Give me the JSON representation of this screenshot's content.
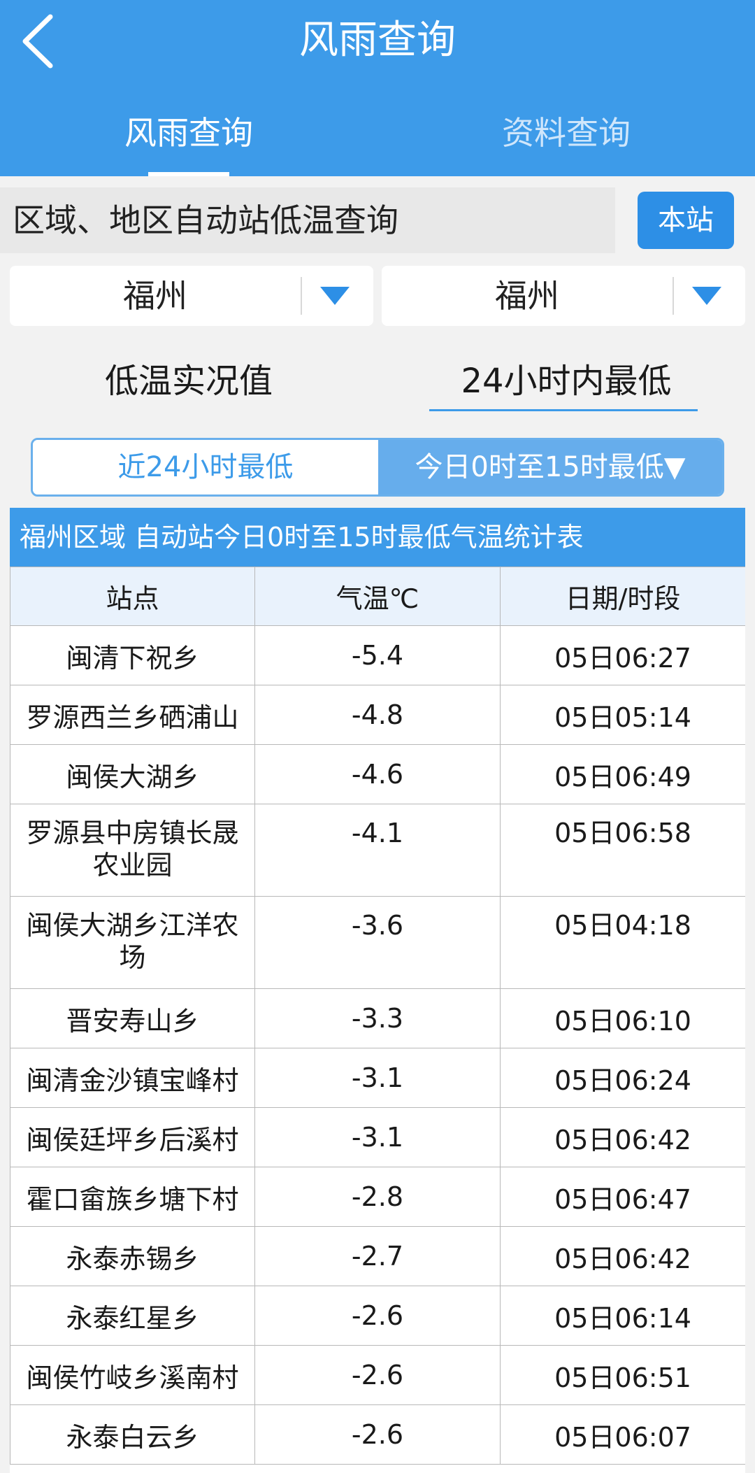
{
  "header": {
    "title": "风雨查询",
    "tabs": [
      {
        "label": "风雨查询",
        "active": true
      },
      {
        "label": "资料查询",
        "active": false
      }
    ],
    "colors": {
      "primary": "#3d9be9",
      "inactive_tab": "#cfe6fb"
    }
  },
  "query": {
    "label": "区域、地区自动站低温查询",
    "station_button": "本站"
  },
  "filters": {
    "region": {
      "selected": "福州"
    },
    "area": {
      "selected": "福州"
    }
  },
  "modes": {
    "live": "低温实况值",
    "min24": "24小时内最低",
    "active": "min24"
  },
  "segment": {
    "left": "近24小时最低",
    "right": "今日0时至15时最低▼",
    "active": "right"
  },
  "table": {
    "title": "福州区域 自动站今日0时至15时最低气温统计表",
    "headers": [
      "站点",
      "气温℃",
      "日期/时段"
    ],
    "rows": [
      {
        "station": "闽清下祝乡",
        "temp": "-5.4",
        "time": "05日06:27"
      },
      {
        "station": "罗源西兰乡硒浦山",
        "temp": "-4.8",
        "time": "05日05:14"
      },
      {
        "station": "闽侯大湖乡",
        "temp": "-4.6",
        "time": "05日06:49"
      },
      {
        "station": "罗源县中房镇长晟农业园",
        "temp": "-4.1",
        "time": "05日06:58"
      },
      {
        "station": "闽侯大湖乡江洋农场",
        "temp": "-3.6",
        "time": "05日04:18"
      },
      {
        "station": "晋安寿山乡",
        "temp": "-3.3",
        "time": "05日06:10"
      },
      {
        "station": "闽清金沙镇宝峰村",
        "temp": "-3.1",
        "time": "05日06:24"
      },
      {
        "station": "闽侯廷坪乡后溪村",
        "temp": "-3.1",
        "time": "05日06:42"
      },
      {
        "station": "霍口畲族乡塘下村",
        "temp": "-2.8",
        "time": "05日06:47"
      },
      {
        "station": "永泰赤锡乡",
        "temp": "-2.7",
        "time": "05日06:42"
      },
      {
        "station": "永泰红星乡",
        "temp": "-2.6",
        "time": "05日06:14"
      },
      {
        "station": "闽侯竹岐乡溪南村",
        "temp": "-2.6",
        "time": "05日06:51"
      },
      {
        "station": "永泰白云乡",
        "temp": "-2.6",
        "time": "05日06:07"
      }
    ]
  }
}
